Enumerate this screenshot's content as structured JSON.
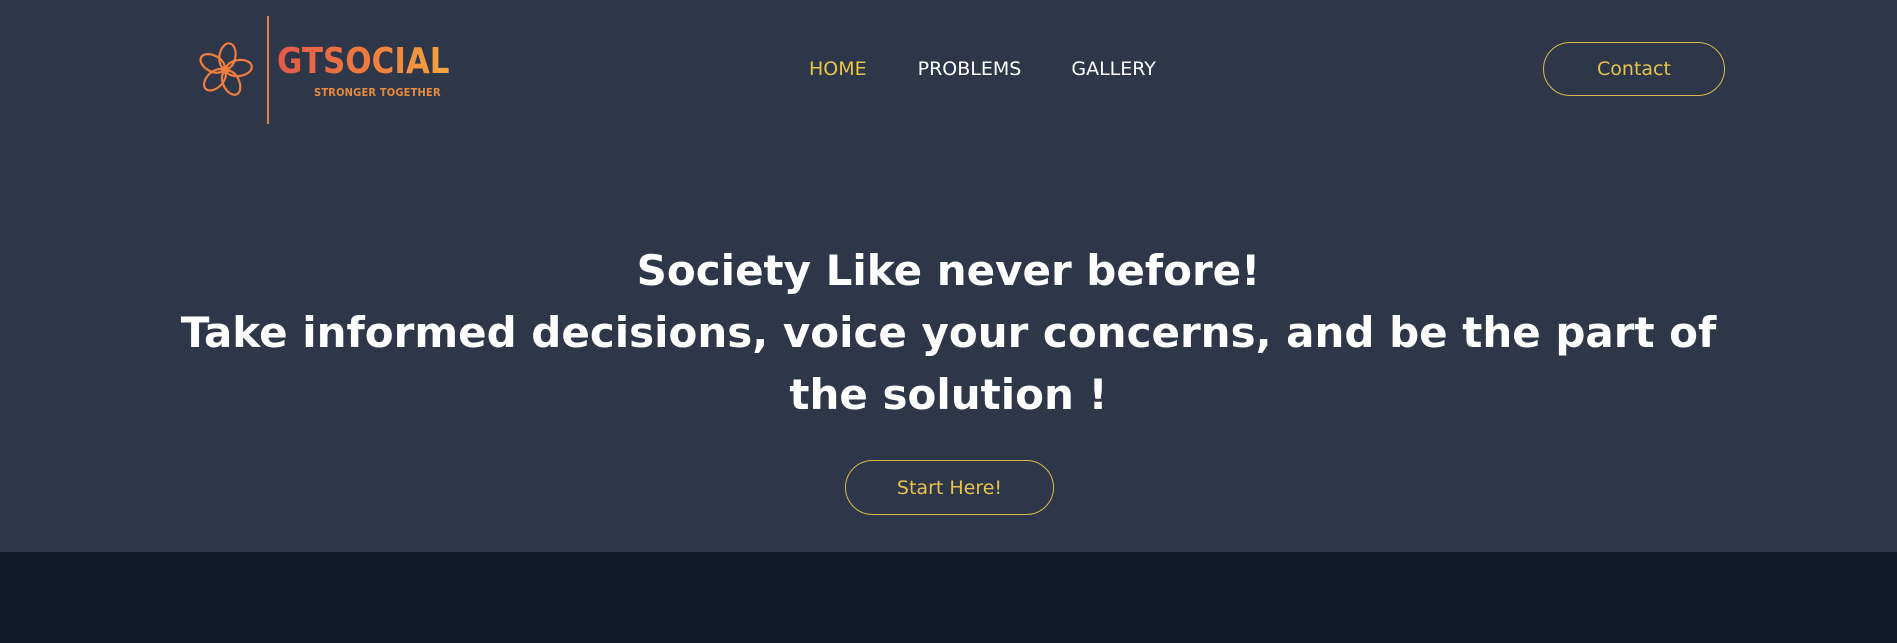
{
  "colors": {
    "header_bg": "#2e3749",
    "bottom_bg": "#111827",
    "accent": "#e6c44a",
    "logo_orange": "#ef7d3d",
    "text": "#ffffff"
  },
  "brand": {
    "name": "GTSOCIAL",
    "tagline": "STRONGER TOGETHER",
    "icon": "flower-logo-icon"
  },
  "nav": {
    "items": [
      {
        "label": "HOME",
        "active": true
      },
      {
        "label": "PROBLEMS",
        "active": false
      },
      {
        "label": "GALLERY",
        "active": false
      }
    ],
    "contact_label": "Contact"
  },
  "hero": {
    "line1": "Society Like never before!",
    "line2": "Take informed decisions, voice your concerns, and be the part of",
    "line3": "the solution !",
    "cta_label": "Start Here!"
  }
}
